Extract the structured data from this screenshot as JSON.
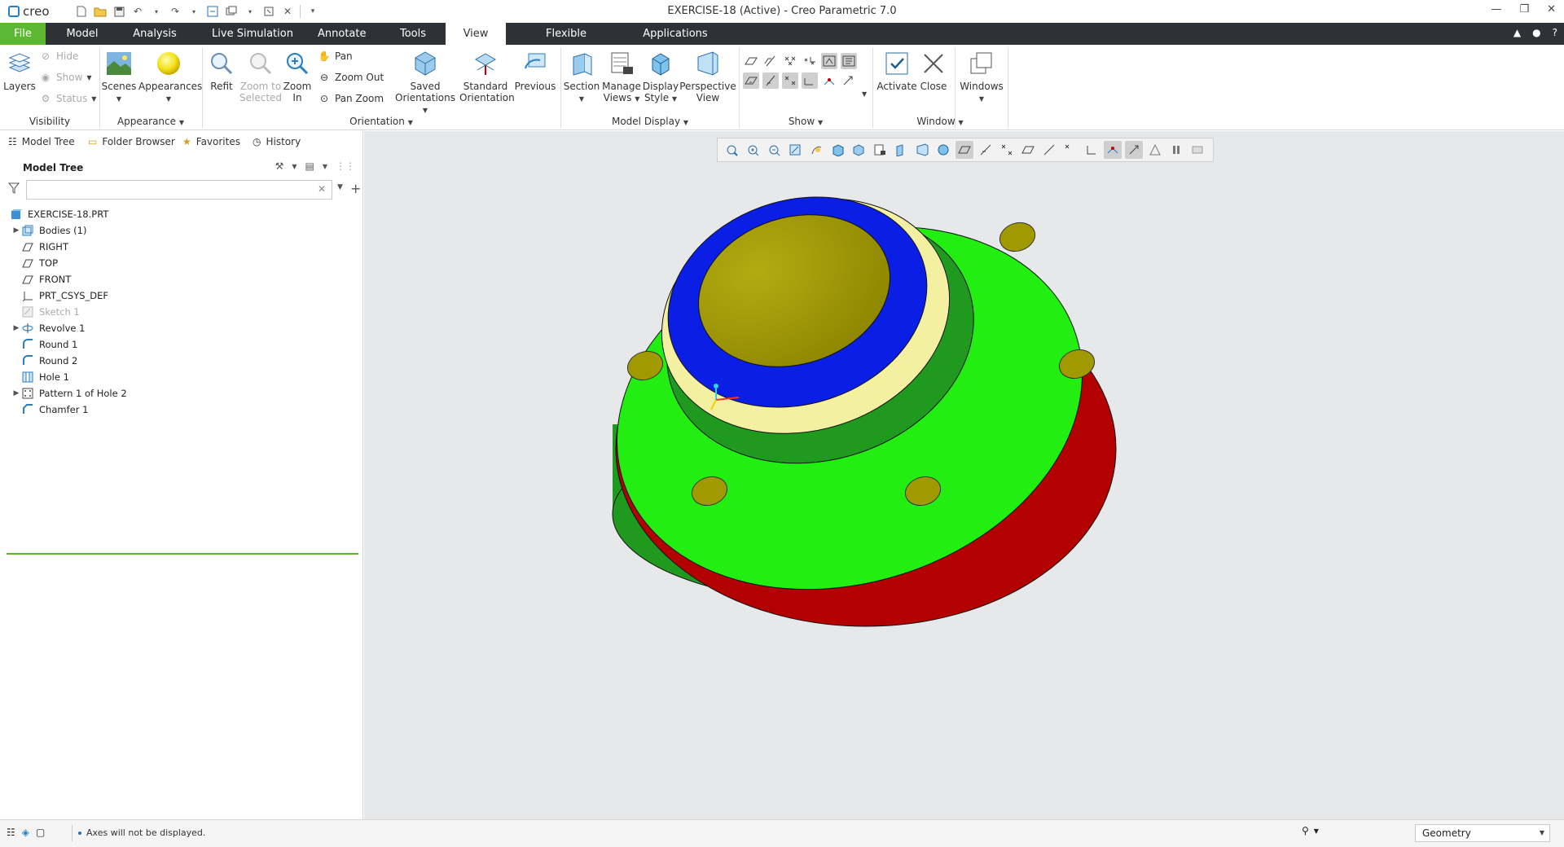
{
  "app": {
    "logo": "creo",
    "title": "EXERCISE-18 (Active) - Creo Parametric 7.0"
  },
  "tabs": [
    "File",
    "Model",
    "Analysis",
    "Live Simulation",
    "Annotate",
    "Tools",
    "View",
    "Flexible Modeling",
    "Applications"
  ],
  "active_tab": "View",
  "ribbon": {
    "visibility": {
      "layers": "Layers",
      "hide": "Hide",
      "show": "Show",
      "status": "Status",
      "group": "Visibility"
    },
    "appearance": {
      "scenes": "Scenes",
      "appearances": "Appearances",
      "group": "Appearance"
    },
    "orientation": {
      "refit": "Refit",
      "zoom_selected_1": "Zoom to",
      "zoom_selected_2": "Selected",
      "zoom_in_1": "Zoom",
      "zoom_in_2": "In",
      "pan": "Pan",
      "zoom_out": "Zoom Out",
      "pan_zoom": "Pan Zoom",
      "saved_1": "Saved",
      "saved_2": "Orientations",
      "standard_1": "Standard",
      "standard_2": "Orientation",
      "previous": "Previous",
      "group": "Orientation"
    },
    "model_display": {
      "section": "Section",
      "manage_1": "Manage",
      "manage_2": "Views",
      "display_1": "Display",
      "display_2": "Style",
      "perspective_1": "Perspective",
      "perspective_2": "View",
      "group": "Model Display"
    },
    "show": {
      "group": "Show"
    },
    "window": {
      "activate": "Activate",
      "close": "Close",
      "windows": "Windows",
      "group": "Window"
    }
  },
  "left_tabs": [
    "Model Tree",
    "Folder Browser",
    "Favorites",
    "History"
  ],
  "model_tree": {
    "title": "Model Tree",
    "search_placeholder": "",
    "items": [
      {
        "label": "EXERCISE-18.PRT",
        "icon": "part-icon",
        "expandable": false,
        "dim": false
      },
      {
        "label": "Bodies (1)",
        "icon": "bodies-icon",
        "expandable": true,
        "dim": false
      },
      {
        "label": "RIGHT",
        "icon": "datum-plane-icon",
        "expandable": false,
        "dim": false
      },
      {
        "label": "TOP",
        "icon": "datum-plane-icon",
        "expandable": false,
        "dim": false
      },
      {
        "label": "FRONT",
        "icon": "datum-plane-icon",
        "expandable": false,
        "dim": false
      },
      {
        "label": "PRT_CSYS_DEF",
        "icon": "csys-icon",
        "expandable": false,
        "dim": false
      },
      {
        "label": "Sketch 1",
        "icon": "sketch-icon",
        "expandable": false,
        "dim": true
      },
      {
        "label": "Revolve 1",
        "icon": "revolve-icon",
        "expandable": true,
        "dim": false
      },
      {
        "label": "Round 1",
        "icon": "round-icon",
        "expandable": false,
        "dim": false
      },
      {
        "label": "Round 2",
        "icon": "round-icon",
        "expandable": false,
        "dim": false
      },
      {
        "label": "Hole 1",
        "icon": "hole-icon",
        "expandable": false,
        "dim": false
      },
      {
        "label": "Pattern 1 of Hole 2",
        "icon": "pattern-icon",
        "expandable": true,
        "dim": false
      },
      {
        "label": "Chamfer 1",
        "icon": "chamfer-icon",
        "expandable": false,
        "dim": false
      }
    ]
  },
  "status": {
    "message": "Axes will not be displayed.",
    "selection_filter": "Geometry"
  },
  "colors": {
    "file_tab": "#5cb832",
    "tab_bar": "#2e3236",
    "flange_top": "#22ee11",
    "flange_side": "#b30000",
    "hub_side": "#1f9a1f",
    "cap_ring": "#0a1ee6",
    "chamfer": "#f3f0a2",
    "cap_face": "#a09a00"
  }
}
